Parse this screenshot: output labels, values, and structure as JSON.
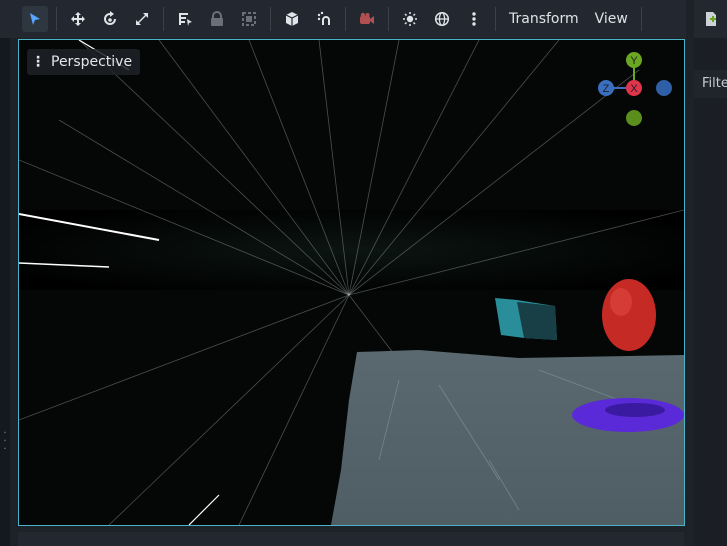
{
  "toolbar": {
    "tools": [
      {
        "name": "select-tool",
        "icon": "arrow-cursor-icon",
        "state": "active"
      },
      {
        "name": "move-tool",
        "icon": "move-icon"
      },
      {
        "name": "rotate-tool",
        "icon": "rotate-icon"
      },
      {
        "name": "scale-tool",
        "icon": "scale-icon"
      },
      {
        "name": "list-select-tool",
        "icon": "list-select-icon"
      },
      {
        "name": "lock-tool",
        "icon": "lock-icon",
        "state": "dim"
      },
      {
        "name": "group-tool",
        "icon": "group-icon",
        "state": "dim"
      },
      {
        "name": "local-space-tool",
        "icon": "cube-icon"
      },
      {
        "name": "snap-tool",
        "icon": "snap-icon"
      },
      {
        "name": "camera-preview-tool",
        "icon": "camera-icon",
        "state": "red"
      },
      {
        "name": "sun-toggle",
        "icon": "sun-icon"
      },
      {
        "name": "environment-toggle",
        "icon": "globe-icon"
      },
      {
        "name": "more-options",
        "icon": "vertical-dots-icon"
      }
    ],
    "menus": {
      "transform": "Transform",
      "view": "View"
    }
  },
  "viewport": {
    "perspective_label": "Perspective",
    "gizmo": {
      "y": "Y",
      "x": "X",
      "z": "Z",
      "y_color": "#6aa622",
      "x_color": "#e0344a",
      "z_color": "#3a6fc0"
    }
  },
  "right_panel": {
    "filter_label": "Filte"
  }
}
